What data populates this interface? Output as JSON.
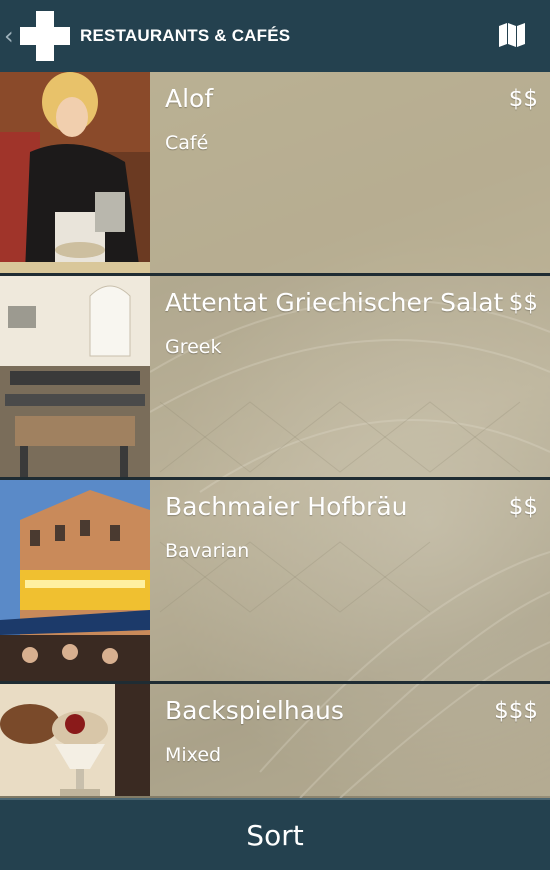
{
  "appbar": {
    "back_glyph": "‹",
    "logo_icon": "plus-logo-icon",
    "title": "RESTAURANTS & CAFÉS",
    "map_icon": "map-icon"
  },
  "restaurants": [
    {
      "name": "Alof",
      "cuisine": "Café",
      "price": "$$"
    },
    {
      "name": "Attentat Griechischer Salat",
      "cuisine": "Greek",
      "price": "$$"
    },
    {
      "name": "Bachmaier Hofbräu",
      "cuisine": "Bavarian",
      "price": "$$"
    },
    {
      "name": "Backspielhaus",
      "cuisine": "Mixed",
      "price": "$$$"
    }
  ],
  "sort": {
    "label": "Sort"
  },
  "colors": {
    "bar": "#24414f",
    "divider": "#1f2c33",
    "text": "#ffffff"
  }
}
